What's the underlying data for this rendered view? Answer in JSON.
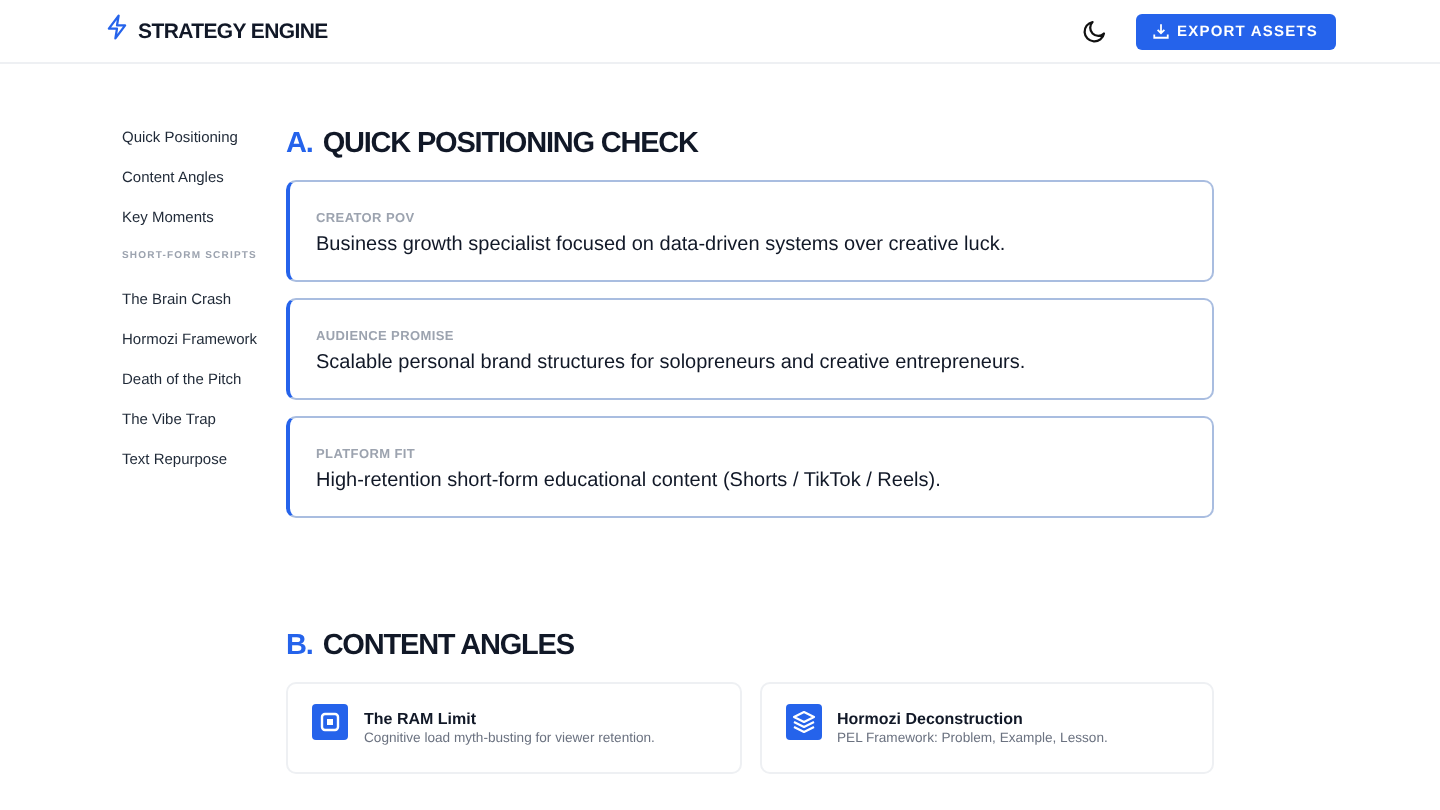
{
  "header": {
    "brand": "STRATEGY ENGINE",
    "export_button": "EXPORT ASSETS"
  },
  "sidebar": {
    "items": [
      {
        "label": "Quick Positioning"
      },
      {
        "label": "Content Angles"
      },
      {
        "label": "Key Moments"
      }
    ],
    "section_heading": "SHORT-FORM SCRIPTS",
    "scripts": [
      {
        "label": "The Brain Crash"
      },
      {
        "label": "Hormozi Framework"
      },
      {
        "label": "Death of the Pitch"
      },
      {
        "label": "The Vibe Trap"
      },
      {
        "label": "Text Repurpose"
      }
    ]
  },
  "positioning": {
    "letter": "A.",
    "title": "QUICK POSITIONING CHECK",
    "cards": [
      {
        "label": "CREATOR POV",
        "text": "Business growth specialist focused on data-driven systems over creative luck."
      },
      {
        "label": "AUDIENCE PROMISE",
        "text": "Scalable personal brand structures for solopreneurs and creative entrepreneurs."
      },
      {
        "label": "PLATFORM FIT",
        "text": "High-retention short-form educational content (Shorts / TikTok / Reels)."
      }
    ]
  },
  "angles": {
    "letter": "B.",
    "title": "CONTENT ANGLES",
    "cards": [
      {
        "kind": "chip",
        "title": "The RAM Limit",
        "description": "Cognitive load myth-busting for viewer retention."
      },
      {
        "kind": "layers",
        "title": "Hormozi Deconstruction",
        "description": "PEL Framework: Problem, Example, Lesson."
      }
    ]
  }
}
